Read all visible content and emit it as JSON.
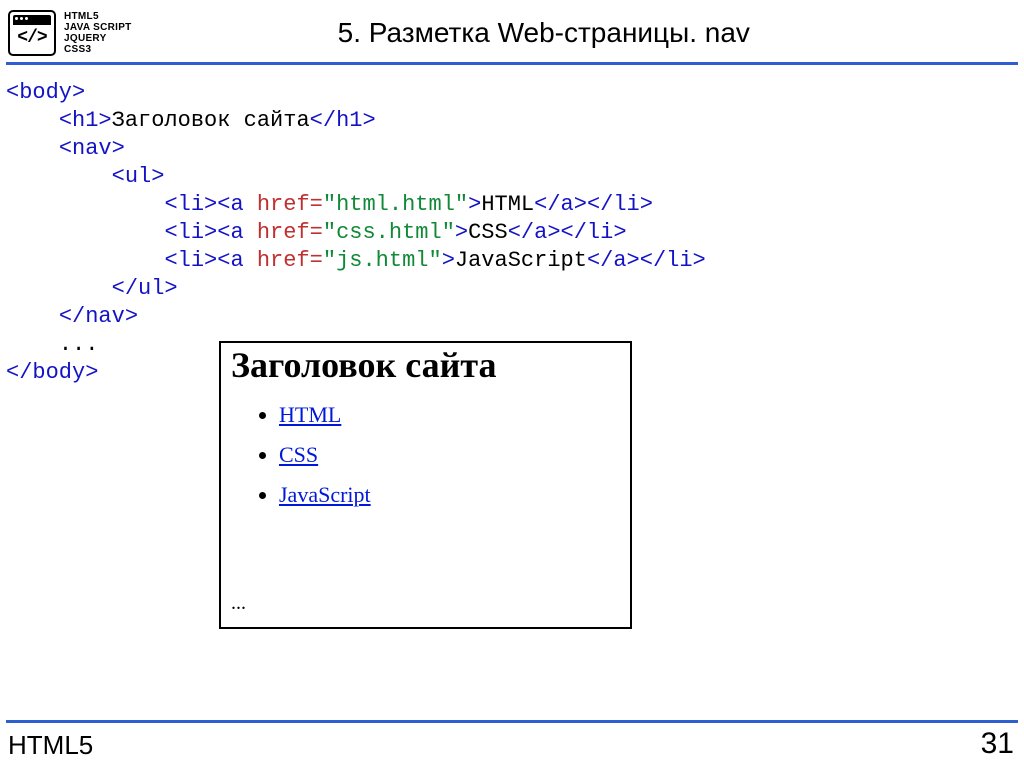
{
  "header": {
    "logo": {
      "glyph": "</>",
      "words": [
        "HTML5",
        "JAVA SCRIPT",
        "JQUERY",
        "CSS3"
      ]
    },
    "title": "5. Разметка Web-страницы. nav"
  },
  "code": {
    "body_open": "<body>",
    "h1_open": "<h1>",
    "h1_text": "Заголовок сайта",
    "h1_close": "</h1>",
    "nav_open": "<nav>",
    "ul_open": "<ul>",
    "li": [
      {
        "li_open": "<li>",
        "a_open": "<a",
        "href_attr": " href=",
        "href_val": "\"html.html\"",
        "gt": ">",
        "text": "HTML",
        "a_close": "</a>",
        "li_close": "</li>"
      },
      {
        "li_open": "<li>",
        "a_open": "<a",
        "href_attr": " href=",
        "href_val": "\"css.html\"",
        "gt": ">",
        "text": "CSS",
        "a_close": "</a>",
        "li_close": "</li>"
      },
      {
        "li_open": "<li>",
        "a_open": "<a",
        "href_attr": " href=",
        "href_val": "\"js.html\"",
        "gt": ">",
        "text": "JavaScript",
        "a_close": "</a>",
        "li_close": "</li>"
      }
    ],
    "ul_close": "</ul>",
    "nav_close": "</nav>",
    "dots": "...",
    "body_close": "</body>"
  },
  "preview": {
    "heading": "Заголовок сайта",
    "links": [
      "HTML",
      "CSS",
      "JavaScript"
    ],
    "dots": "..."
  },
  "footer": {
    "left": "HTML5",
    "right": "31"
  }
}
